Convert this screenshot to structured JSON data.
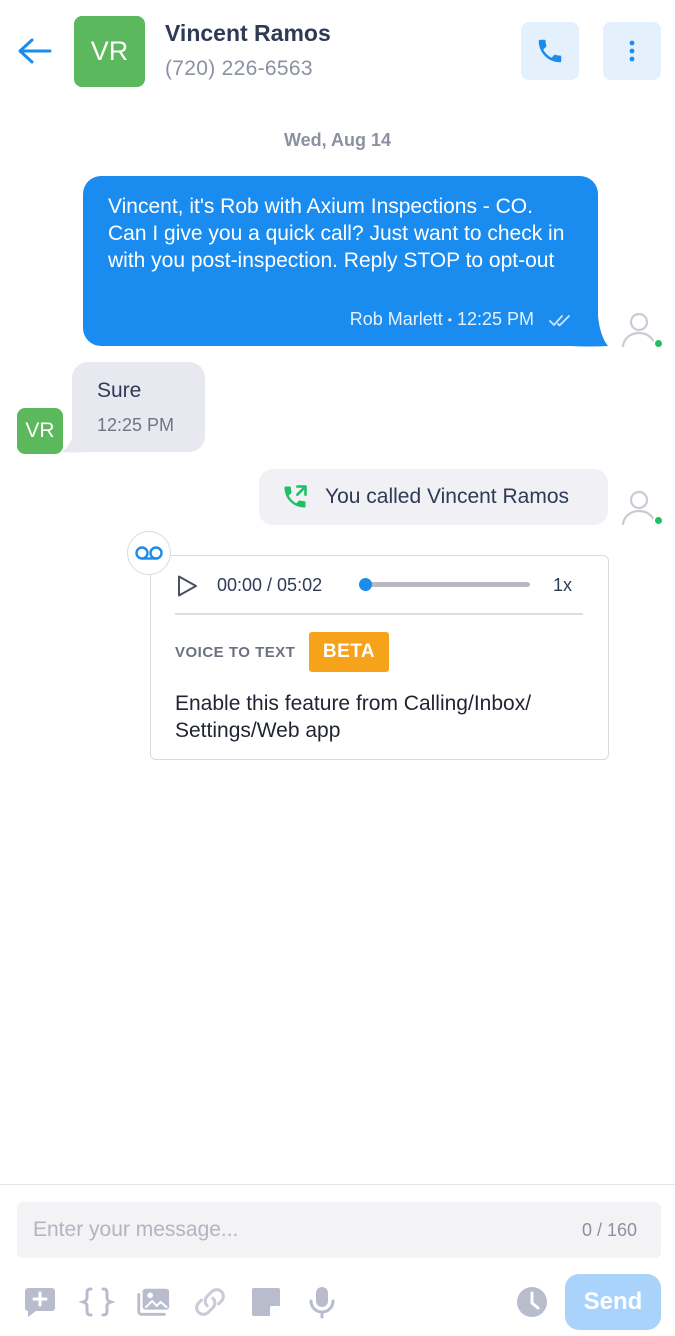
{
  "header": {
    "avatar_initials": "VR",
    "contact_name": "Vincent Ramos",
    "contact_phone": "(720) 226-6563"
  },
  "thread": {
    "date_separator": "Wed, Aug 14",
    "outgoing_message": {
      "text": "Vincent, it's Rob with Axium Inspections - CO. Can I give you a quick call? Just want to check in with you post-inspection. Reply STOP to opt-out",
      "sender": "Rob Marlett",
      "separator": "•",
      "time": "12:25 PM"
    },
    "incoming_message": {
      "avatar_initials": "VR",
      "text": "Sure",
      "time": "12:25 PM"
    },
    "call_event": {
      "text": "You called Vincent Ramos"
    },
    "voicemail": {
      "time_display": "00:00 / 05:02",
      "progress": 0.0,
      "speed": "1x",
      "voice_to_text_label": "VOICE TO TEXT",
      "beta_label": "BETA",
      "info_text": "Enable this feature from Calling/Inbox/ Settings/Web app"
    }
  },
  "composer": {
    "placeholder": "Enter your message...",
    "char_count": "0 / 160",
    "send_label": "Send"
  },
  "colors": {
    "accent": "#1a8cf0",
    "avatar_green": "#5cb85c",
    "beta_orange": "#f7a21b",
    "online_green": "#1fbf63"
  }
}
